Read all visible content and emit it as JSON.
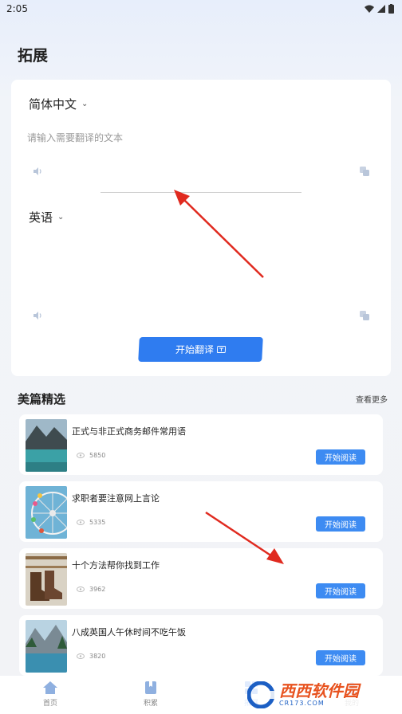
{
  "status_bar": {
    "time": "2:05"
  },
  "page": {
    "title": "拓展"
  },
  "translator": {
    "source_language": "简体中文",
    "target_language": "英语",
    "input_placeholder": "请输入需要翻译的文本",
    "input_value": "",
    "translate_button_label": "开始翻译"
  },
  "featured": {
    "section_title": "美篇精选",
    "see_more": "查看更多",
    "articles": [
      {
        "title": "正式与非正式商务邮件常用语",
        "views": "5850",
        "read_label": "开始阅读"
      },
      {
        "title": "求职者要注意网上言论",
        "views": "5335",
        "read_label": "开始阅读"
      },
      {
        "title": "十个方法帮你找到工作",
        "views": "3962",
        "read_label": "开始阅读"
      },
      {
        "title": "八成英国人午休时间不吃午饭",
        "views": "3820",
        "read_label": "开始阅读"
      }
    ]
  },
  "bottom_nav": {
    "items": [
      {
        "label": "首页",
        "icon": "home-icon"
      },
      {
        "label": "积累",
        "icon": "bookmark-icon"
      },
      {
        "label": "拓展",
        "icon": "expand-icon"
      },
      {
        "label": "我的",
        "icon": "profile-icon"
      }
    ]
  },
  "watermark": {
    "text": "西西软件园",
    "sub": "CR173.COM"
  },
  "colors": {
    "accent": "#2f7cf0",
    "annotation_arrow": "#e02a1f"
  }
}
